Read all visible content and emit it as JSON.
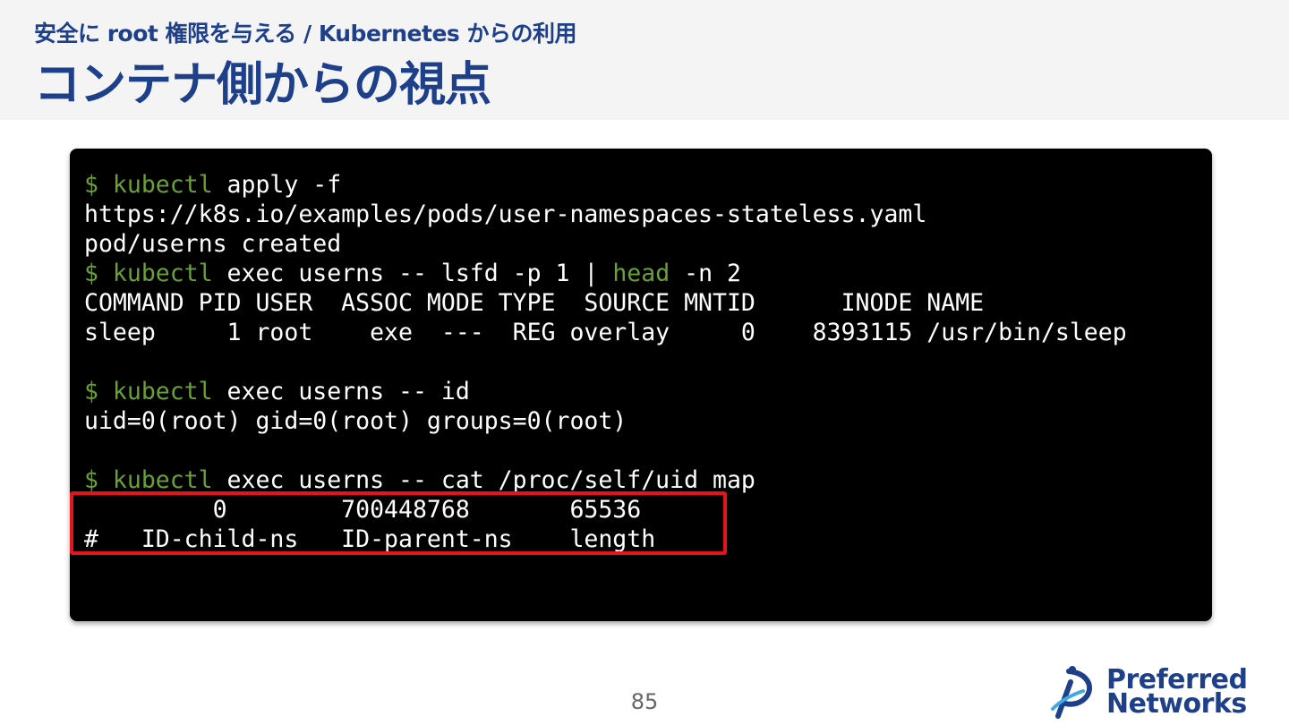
{
  "slide": {
    "subtitle": "安全に root 権限を与える / Kubernetes からの利用",
    "title": "コンテナ側からの視点",
    "page_number": "85"
  },
  "logo": {
    "line1": "Preferred",
    "line2": "Networks"
  },
  "terminal": {
    "lines": [
      {
        "segments": [
          {
            "text": "$ kubectl",
            "color": "green"
          },
          {
            "text": " apply -f",
            "color": "white"
          }
        ]
      },
      {
        "segments": [
          {
            "text": "https://k8s.io/examples/pods/user-namespaces-stateless.yaml",
            "color": "white"
          }
        ]
      },
      {
        "segments": [
          {
            "text": "pod/userns created",
            "color": "white"
          }
        ]
      },
      {
        "segments": [
          {
            "text": "$ kubectl",
            "color": "green"
          },
          {
            "text": " exec userns -- lsfd -p 1 | ",
            "color": "white"
          },
          {
            "text": "head",
            "color": "green"
          },
          {
            "text": " -n 2",
            "color": "white"
          }
        ]
      },
      {
        "segments": [
          {
            "text": "COMMAND PID USER  ASSOC MODE TYPE  SOURCE MNTID      INODE NAME",
            "color": "white"
          }
        ]
      },
      {
        "segments": [
          {
            "text": "sleep     1 root    exe  ---  REG overlay     0    8393115 /usr/bin/sleep",
            "color": "white"
          }
        ]
      },
      {
        "segments": [
          {
            "text": "",
            "color": "white"
          }
        ]
      },
      {
        "segments": [
          {
            "text": "$ kubectl",
            "color": "green"
          },
          {
            "text": " exec userns -- id",
            "color": "white"
          }
        ]
      },
      {
        "segments": [
          {
            "text": "uid=0(root) gid=0(root) groups=0(root)",
            "color": "white"
          }
        ]
      },
      {
        "segments": [
          {
            "text": "",
            "color": "white"
          }
        ]
      },
      {
        "segments": [
          {
            "text": "$ kubectl",
            "color": "green"
          },
          {
            "text": " exec userns -- cat /proc/self/uid_map",
            "color": "white"
          }
        ]
      },
      {
        "segments": [
          {
            "text": "         0        700448768       65536",
            "color": "white"
          }
        ]
      },
      {
        "segments": [
          {
            "text": "#   ID-child-ns   ID-parent-ns    length",
            "color": "white"
          }
        ]
      }
    ]
  },
  "colors": {
    "title": "#1e3f8a",
    "prompt_green": "#6aa136",
    "highlight_red": "#e3141c",
    "terminal_bg": "#000000"
  }
}
